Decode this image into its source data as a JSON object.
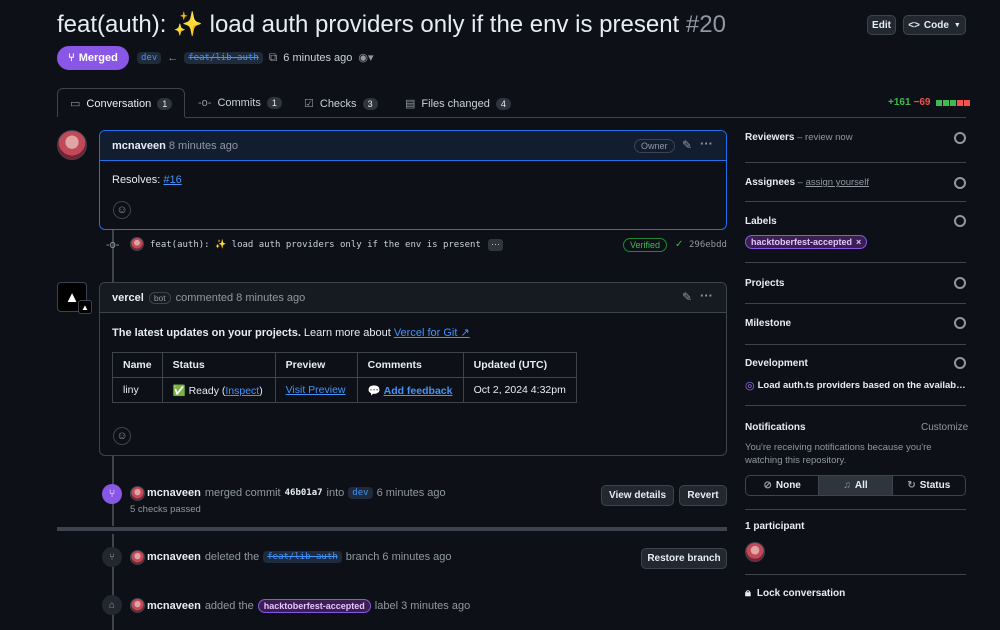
{
  "pr": {
    "title": "feat(auth): ✨ load auth providers only if the env is present",
    "number": "#20",
    "state": "Merged",
    "base_branch": "dev",
    "head_branch": "feat/lib-auth",
    "time_ago": "6 minutes ago"
  },
  "header_buttons": {
    "edit": "Edit",
    "code": "Code"
  },
  "tabs": [
    {
      "label": "Conversation",
      "count": "1"
    },
    {
      "label": "Commits",
      "count": "1"
    },
    {
      "label": "Checks",
      "count": "3"
    },
    {
      "label": "Files changed",
      "count": "4"
    }
  ],
  "diffstat": {
    "added": "+161",
    "removed": "−69"
  },
  "comment1": {
    "author": "mcnaveen",
    "time": "8 minutes ago",
    "badge": "Owner",
    "body_prefix": "Resolves: ",
    "body_link": "#16"
  },
  "commit": {
    "message": "feat(auth): ✨ load auth providers only if the env is present",
    "more": "···",
    "verified": "Verified",
    "sha": "296ebdd"
  },
  "comment2": {
    "author": "vercel",
    "bot_label": "bot",
    "action": "commented 8 minutes ago",
    "intro_bold": "The latest updates on your projects.",
    "intro_rest": " Learn more about ",
    "intro_link": "Vercel for Git ↗",
    "table": {
      "headers": [
        "Name",
        "Status",
        "Preview",
        "Comments",
        "Updated (UTC)"
      ],
      "row": {
        "name": "liny",
        "status_prefix": "✅ Ready (",
        "status_link": "Inspect",
        "status_suffix": ")",
        "preview": "Visit Preview",
        "comments_icon": "💬",
        "comments": "Add feedback",
        "updated": "Oct 2, 2024 4:32pm"
      }
    }
  },
  "merge_event": {
    "author": "mcnaveen",
    "text1": "merged commit",
    "sha": "46b01a7",
    "text2": "into",
    "branch": "dev",
    "time": "6 minutes ago",
    "checks": "5 checks passed",
    "view_details": "View details",
    "revert": "Revert"
  },
  "delete_event": {
    "author": "mcnaveen",
    "text1": "deleted the",
    "branch": "feat/lib-auth",
    "text2": "branch 6 minutes ago",
    "restore": "Restore branch"
  },
  "label_event": {
    "author": "mcnaveen",
    "text1": "added the",
    "label": "hacktoberfest-accepted",
    "text2": "label 3 minutes ago"
  },
  "sidebar": {
    "reviewers": {
      "title": "Reviewers",
      "sep": " – ",
      "value": "review now"
    },
    "assignees": {
      "title": "Assignees",
      "sep": " – ",
      "value": "assign yourself"
    },
    "labels": {
      "title": "Labels",
      "label": "hacktoberfest-accepted",
      "remove": "×"
    },
    "projects": {
      "title": "Projects"
    },
    "milestone": {
      "title": "Milestone"
    },
    "development": {
      "title": "Development",
      "item": "Load auth.ts providers based on the availab…"
    },
    "notifications": {
      "title": "Notifications",
      "customize": "Customize",
      "text": "You're receiving notifications because you're watching this repository.",
      "options": [
        "None",
        "All",
        "Status"
      ]
    },
    "participants": {
      "title": "1 participant"
    },
    "lock": "Lock conversation"
  },
  "colors": {
    "merged": "#8957e5",
    "accent": "#4493f8",
    "added": "#3fb950",
    "removed": "#f85149"
  }
}
